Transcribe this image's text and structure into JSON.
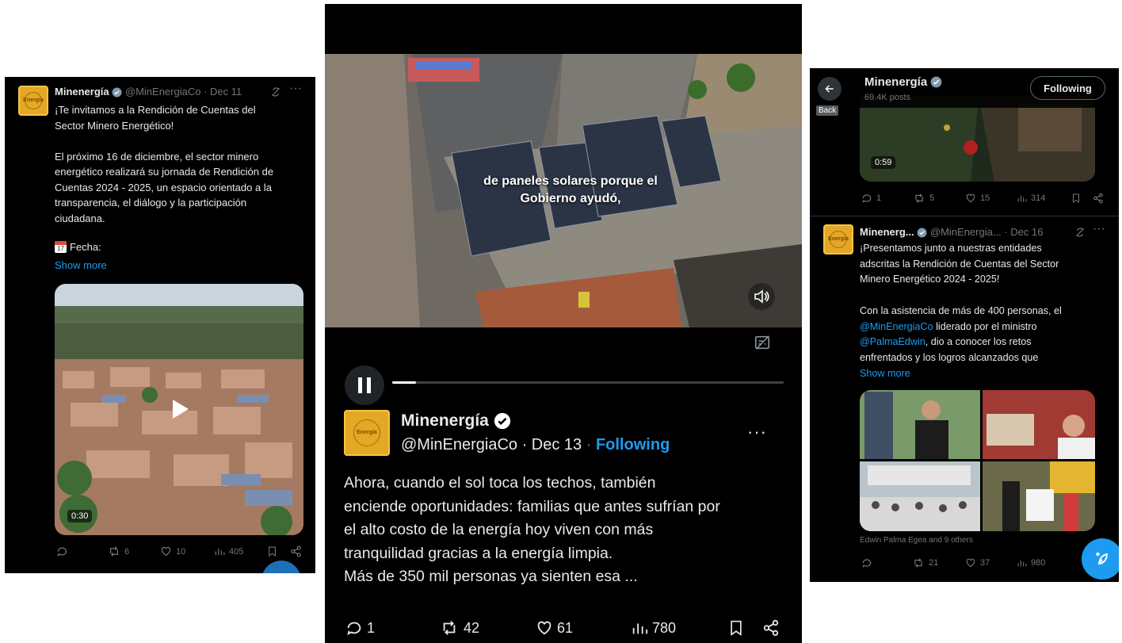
{
  "panel1": {
    "display_name": "Minenergía",
    "handle": "@MinEnergiaCo",
    "date": "· Dec 11",
    "avatar_text": "Energía",
    "text": "¡Te invitamos a la Rendición de Cuentas del\nSector Minero Energético!\n\nEl próximo 16 de diciembre, el sector minero\nenergético realizará su jornada de Rendición de\nCuentas 2024 - 2025, un espacio orientado a la\ntransparencia, el diálogo y la participación\nciudadana.",
    "fecha_label": "Fecha:",
    "calendar_day": "17",
    "show_more": "Show more",
    "duration": "0:30",
    "stats": {
      "replies": "",
      "reposts": "6",
      "likes": "10",
      "views": "405"
    }
  },
  "panel2": {
    "caption": "de paneles solares porque el\nGobierno ayudó,",
    "display_name": "Minenergía",
    "handle": "@MinEnergiaCo",
    "date": "· Dec 13",
    "follow": "Following",
    "avatar_text": "Energía",
    "text": "Ahora, cuando el sol toca los techos, también\nenciende oportunidades: familias que antes sufrían por\nel alto costo de la energía hoy viven con más\ntranquilidad gracias a la energía limpia.\nMás de 350 mil personas ya sienten esa ...",
    "progress": 0.06,
    "stats": {
      "replies": "1",
      "reposts": "42",
      "likes": "61",
      "views": "780"
    }
  },
  "panel3": {
    "header_name": "Minenergía",
    "header_posts": "69.4K posts",
    "back_tooltip": "Back",
    "follow": "Following",
    "prev_duration": "0:59",
    "prev_stats": {
      "replies": "1",
      "reposts": "5",
      "likes": "15",
      "views": "314"
    },
    "display_name": "Minenerg...",
    "handle": "@MinEnergia...",
    "date": "· Dec 16",
    "avatar_text": "Energía",
    "text_line1": "¡Presentamos junto a nuestras entidades",
    "text_line2": "adscritas la Rendición de Cuentas del Sector",
    "text_line3": "Minero Energético 2024 - 2025!",
    "text_line5": "Con la asistencia de más de 400 personas, el",
    "mention1": "@MinEnergiaCo",
    "text_after_mention1": " liderado por el ministro",
    "mention2": "@PalmaEdwin",
    "text_after_mention2": ", dio a conocer los retos",
    "text_line8": "enfrentados y los logros alcanzados que",
    "show_more": "Show more",
    "tagged": "Edwin Palma Egea and 9 others",
    "stats": {
      "replies": "",
      "reposts": "21",
      "likes": "37",
      "views": "980"
    }
  },
  "colors": {
    "accent": "#1d9bf0",
    "background": "#000000",
    "muted": "#71767b",
    "verified": "#829aab"
  }
}
